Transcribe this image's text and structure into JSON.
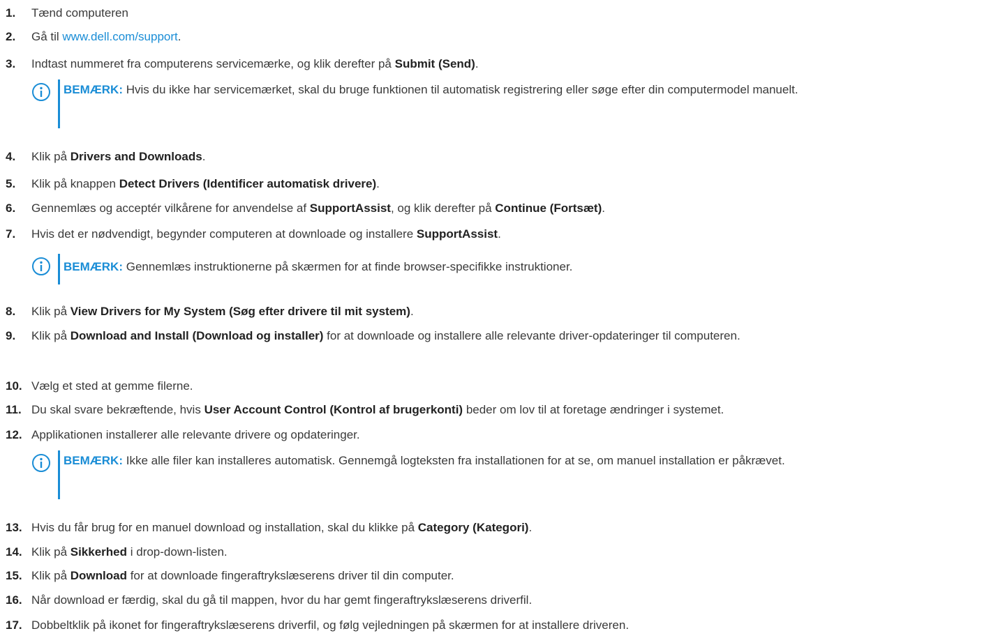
{
  "steps": [
    {
      "num": "1.",
      "parts": [
        {
          "t": "Tænd computeren"
        }
      ]
    },
    {
      "num": "2.",
      "parts": [
        {
          "t": "Gå til "
        },
        {
          "t": "www.dell.com/support",
          "link": true
        },
        {
          "t": "."
        }
      ]
    },
    {
      "num": "3.",
      "parts": [
        {
          "t": "Indtast nummeret fra computerens servicemærke, og klik derefter på "
        },
        {
          "t": "Submit (Send)",
          "b": true
        },
        {
          "t": "."
        }
      ]
    },
    {
      "num": "4.",
      "parts": [
        {
          "t": "Klik på "
        },
        {
          "t": "Drivers and Downloads",
          "b": true
        },
        {
          "t": "."
        }
      ]
    },
    {
      "num": "5.",
      "parts": [
        {
          "t": "Klik på knappen "
        },
        {
          "t": "Detect Drivers (Identificer automatisk drivere)",
          "b": true
        },
        {
          "t": "."
        }
      ]
    },
    {
      "num": "6.",
      "parts": [
        {
          "t": "Gennemlæs og acceptér vilkårene for anvendelse af "
        },
        {
          "t": "SupportAssist",
          "b": true
        },
        {
          "t": ", og klik derefter på "
        },
        {
          "t": "Continue (Fortsæt)",
          "b": true
        },
        {
          "t": "."
        }
      ]
    },
    {
      "num": "7.",
      "parts": [
        {
          "t": "Hvis det er nødvendigt, begynder computeren at downloade og installere "
        },
        {
          "t": "SupportAssist",
          "b": true
        },
        {
          "t": "."
        }
      ]
    },
    {
      "num": "8.",
      "parts": [
        {
          "t": "Klik på "
        },
        {
          "t": "View Drivers for My System (Søg efter drivere til mit system)",
          "b": true
        },
        {
          "t": "."
        }
      ]
    },
    {
      "num": "9.",
      "parts": [
        {
          "t": "Klik på "
        },
        {
          "t": "Download and Install (Download og installer)",
          "b": true
        },
        {
          "t": " for at downloade og installere alle relevante driver-opdateringer til computeren."
        }
      ]
    },
    {
      "num": "10.",
      "parts": [
        {
          "t": "Vælg et sted at gemme filerne."
        }
      ]
    },
    {
      "num": "11.",
      "parts": [
        {
          "t": "Du skal svare bekræftende, hvis "
        },
        {
          "t": "User Account Control (Kontrol af brugerkonti)",
          "b": true
        },
        {
          "t": " beder om lov til at foretage ændringer i systemet."
        }
      ]
    },
    {
      "num": "12.",
      "parts": [
        {
          "t": "Applikationen installerer alle relevante drivere og opdateringer."
        }
      ]
    },
    {
      "num": "13.",
      "parts": [
        {
          "t": "Hvis du får brug for en manuel download og installation, skal du klikke på "
        },
        {
          "t": "Category (Kategori)",
          "b": true
        },
        {
          "t": "."
        }
      ]
    },
    {
      "num": "14.",
      "parts": [
        {
          "t": "Klik på "
        },
        {
          "t": "Sikkerhed",
          "b": true
        },
        {
          "t": " i drop-down-listen."
        }
      ]
    },
    {
      "num": "15.",
      "parts": [
        {
          "t": "Klik på "
        },
        {
          "t": "Download",
          "b": true
        },
        {
          "t": " for at downloade fingeraftrykslæserens driver til din computer."
        }
      ]
    },
    {
      "num": "16.",
      "parts": [
        {
          "t": "Når download er færdig, skal du gå til mappen, hvor du har gemt fingeraftrykslæserens driverfil."
        }
      ]
    },
    {
      "num": "17.",
      "parts": [
        {
          "t": "Dobbeltklik på ikonet for fingeraftrykslæserens driverfil, og følg vejledningen på skærmen for at installere driveren."
        }
      ]
    }
  ],
  "notes": [
    {
      "label": "BEMÆRK:",
      "text": " Hvis du ikke har servicemærket, skal du bruge funktionen til automatisk registrering eller søge efter din computermodel manuelt."
    },
    {
      "label": "BEMÆRK:",
      "text": " Gennemlæs instruktionerne på skærmen for at finde browser-specifikke instruktioner."
    },
    {
      "label": "BEMÆRK:",
      "text": " Ikke alle filer kan installeres automatisk. Gennemgå logteksten fra installationen for at se, om manuel installation er påkrævet."
    }
  ],
  "icons": {
    "note": "info-icon"
  },
  "colors": {
    "link": "#1a8dd6",
    "note_label": "#1a8dd6",
    "text": "#3a3a3a"
  }
}
